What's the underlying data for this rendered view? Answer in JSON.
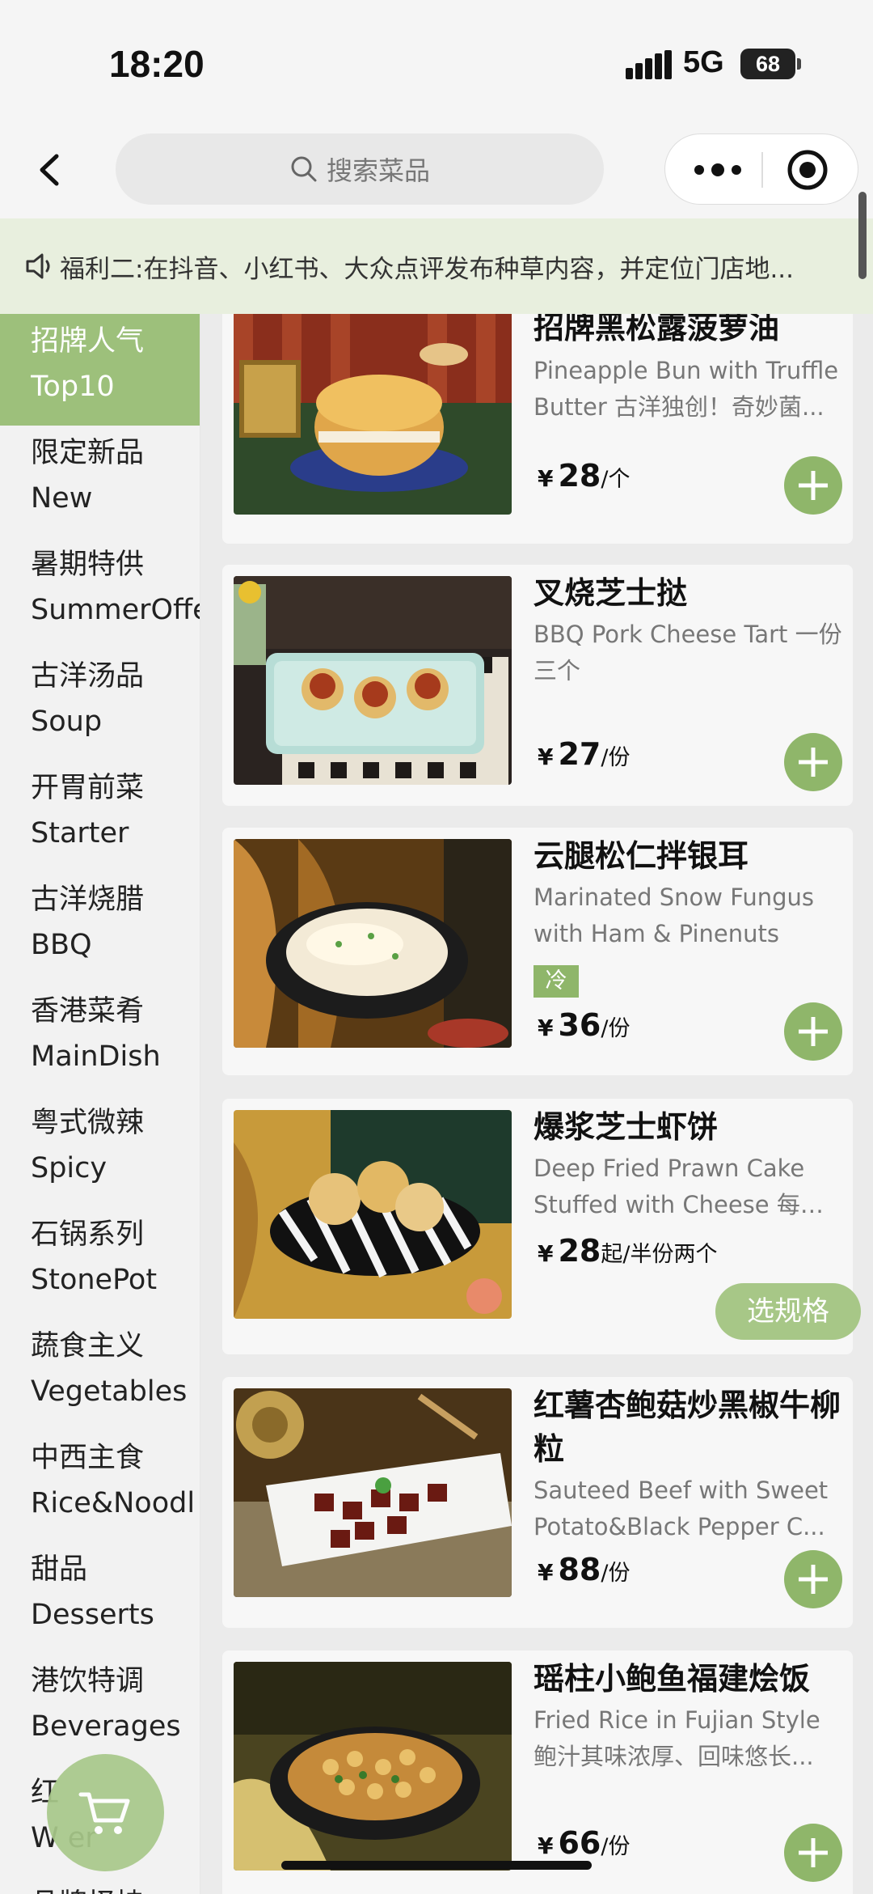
{
  "status": {
    "time": "18:20",
    "network": "5G",
    "battery": "68"
  },
  "nav": {
    "search_placeholder": "搜索菜品"
  },
  "notice": {
    "text": "福利二:在抖音、小红书、大众点评发布种草内容，并定位门店地..."
  },
  "sidebar": {
    "items": [
      {
        "zh": "招牌人气",
        "en": "Top10",
        "active": true
      },
      {
        "zh": "限定新品",
        "en": "New"
      },
      {
        "zh": "暑期特供",
        "en": "SummerOffe"
      },
      {
        "zh": "古洋汤品",
        "en": "Soup"
      },
      {
        "zh": "开胃前菜",
        "en": "Starter"
      },
      {
        "zh": "古洋烧腊",
        "en": "BBQ"
      },
      {
        "zh": "香港菜肴",
        "en": "MainDish"
      },
      {
        "zh": "粤式微辣",
        "en": "Spicy"
      },
      {
        "zh": "石锅系列",
        "en": "StonePot"
      },
      {
        "zh": "蔬食主义",
        "en": "Vegetables"
      },
      {
        "zh": "中西主食",
        "en": "Rice&Noodl"
      },
      {
        "zh": "甜品",
        "en": "Desserts"
      },
      {
        "zh": "港饮特调",
        "en": "Beverages"
      },
      {
        "zh": "红",
        "en": "W         er"
      },
      {
        "zh": "品牌怪持",
        "en": ""
      }
    ]
  },
  "products": [
    {
      "name": "招牌黑松露菠萝油",
      "desc": "Pineapple Bun with Truffle Butter 古洋独创！奇妙菌...",
      "yen": "¥",
      "price": "28",
      "unit": "/个",
      "action": "add"
    },
    {
      "name": "叉烧芝士挞",
      "desc": "BBQ Pork Cheese Tart 一份三个",
      "yen": "¥",
      "price": "27",
      "unit": "/份",
      "action": "add"
    },
    {
      "name": "云腿松仁拌银耳",
      "desc": "Marinated Snow Fungus with Ham & Pinenuts",
      "tag": "冷",
      "yen": "¥",
      "price": "36",
      "unit": "/份",
      "action": "add"
    },
    {
      "name": "爆浆芝士虾饼",
      "desc": "Deep Fried Prawn Cake Stuffed with Cheese 每块...",
      "yen": "¥",
      "price": "28",
      "unit": "起/半份两个",
      "action": "spec",
      "action_label": "选规格"
    },
    {
      "name": "红薯杏鲍菇炒黑椒牛柳粒",
      "desc": "Sauteed Beef with Sweet Potato&Black Pepper C...",
      "yen": "¥",
      "price": "88",
      "unit": "/份",
      "action": "add"
    },
    {
      "name": "瑶柱小鲍鱼福建烩饭",
      "desc": "Fried Rice in Fujian Style 鲍汁其味浓厚、回味悠长...",
      "yen": "¥",
      "price": "66",
      "unit": "/份",
      "action": "add"
    }
  ],
  "colors": {
    "accent": "#8fb66a",
    "notice_bg": "#e8efde",
    "sidebar_active": "#9dc07b"
  }
}
